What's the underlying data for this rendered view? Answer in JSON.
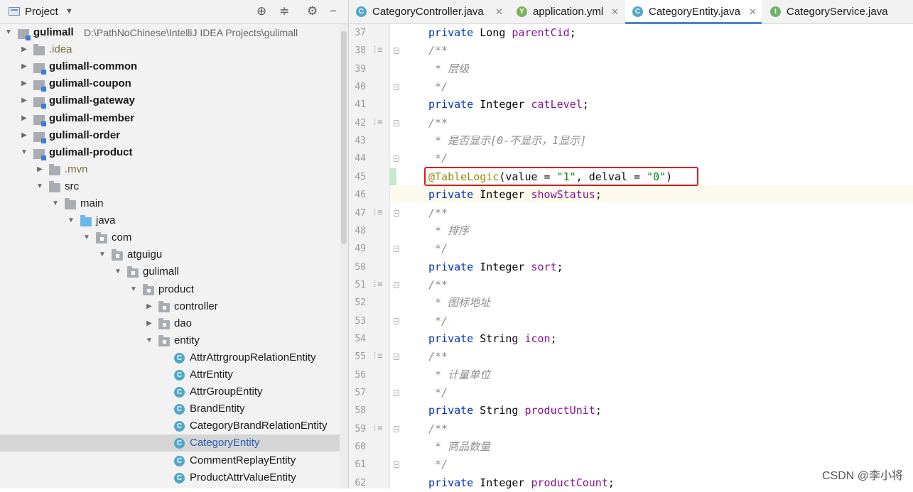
{
  "project": {
    "title": "Project",
    "tree": [
      {
        "label": "gulimall",
        "path": "D:\\PathNoChinese\\IntelliJ IDEA Projects\\gulimall",
        "icon": "module",
        "depth": 0,
        "expanded": true,
        "bold": true
      },
      {
        "label": ".idea",
        "icon": "folder",
        "depth": 1,
        "expanded": false,
        "hint": true
      },
      {
        "label": "gulimall-common",
        "icon": "module",
        "depth": 1,
        "expanded": false,
        "bold": true
      },
      {
        "label": "gulimall-coupon",
        "icon": "module",
        "depth": 1,
        "expanded": false,
        "bold": true
      },
      {
        "label": "gulimall-gateway",
        "icon": "module",
        "depth": 1,
        "expanded": false,
        "bold": true
      },
      {
        "label": "gulimall-member",
        "icon": "module",
        "depth": 1,
        "expanded": false,
        "bold": true
      },
      {
        "label": "gulimall-order",
        "icon": "module",
        "depth": 1,
        "expanded": false,
        "bold": true
      },
      {
        "label": "gulimall-product",
        "icon": "module",
        "depth": 1,
        "expanded": true,
        "bold": true
      },
      {
        "label": ".mvn",
        "icon": "folder",
        "depth": 2,
        "expanded": false,
        "hint": true
      },
      {
        "label": "src",
        "icon": "folder",
        "depth": 2,
        "expanded": true
      },
      {
        "label": "main",
        "icon": "folder",
        "depth": 3,
        "expanded": true
      },
      {
        "label": "java",
        "icon": "folder-blue",
        "depth": 4,
        "expanded": true
      },
      {
        "label": "com",
        "icon": "package",
        "depth": 5,
        "expanded": true
      },
      {
        "label": "atguigu",
        "icon": "package",
        "depth": 6,
        "expanded": true
      },
      {
        "label": "gulimall",
        "icon": "package",
        "depth": 7,
        "expanded": true
      },
      {
        "label": "product",
        "icon": "package",
        "depth": 8,
        "expanded": true
      },
      {
        "label": "controller",
        "icon": "package",
        "depth": 9,
        "expanded": false
      },
      {
        "label": "dao",
        "icon": "package",
        "depth": 9,
        "expanded": false
      },
      {
        "label": "entity",
        "icon": "package",
        "depth": 9,
        "expanded": true
      },
      {
        "label": "AttrAttrgroupRelationEntity",
        "icon": "class",
        "depth": 10
      },
      {
        "label": "AttrEntity",
        "icon": "class",
        "depth": 10
      },
      {
        "label": "AttrGroupEntity",
        "icon": "class",
        "depth": 10
      },
      {
        "label": "BrandEntity",
        "icon": "class",
        "depth": 10
      },
      {
        "label": "CategoryBrandRelationEntity",
        "icon": "class",
        "depth": 10
      },
      {
        "label": "CategoryEntity",
        "icon": "class",
        "depth": 10,
        "selected": true
      },
      {
        "label": "CommentReplayEntity",
        "icon": "class",
        "depth": 10
      },
      {
        "label": "ProductAttrValueEntity",
        "icon": "class",
        "depth": 10
      }
    ]
  },
  "tabs": [
    {
      "label": "CategoryController.java",
      "icon": "C",
      "color": "#4fa7c9",
      "closable": true,
      "active": false
    },
    {
      "label": "application.yml",
      "icon": "Y",
      "color": "#7bb35a",
      "closable": true,
      "active": false
    },
    {
      "label": "CategoryEntity.java",
      "icon": "C",
      "color": "#4fa7c9",
      "closable": true,
      "active": true
    },
    {
      "label": "CategoryService.java",
      "icon": "I",
      "color": "#6cb36a",
      "closable": false,
      "active": false
    }
  ],
  "code": [
    {
      "n": "37",
      "tokens": [
        [
          "kw",
          "private "
        ],
        [
          "",
          "Long "
        ],
        [
          "fld",
          "parentCid"
        ],
        [
          "",
          ";"
        ]
      ]
    },
    {
      "n": "38",
      "comment": true,
      "fold": true,
      "text": "/**"
    },
    {
      "n": "39",
      "comment": true,
      "text": " * 层级"
    },
    {
      "n": "40",
      "comment": true,
      "foldEnd": true,
      "text": " */"
    },
    {
      "n": "41",
      "tokens": [
        [
          "kw",
          "private "
        ],
        [
          "",
          "Integer "
        ],
        [
          "fld",
          "catLevel"
        ],
        [
          "",
          ";"
        ]
      ]
    },
    {
      "n": "42",
      "comment": true,
      "fold": true,
      "text": "/**"
    },
    {
      "n": "43",
      "comment": true,
      "text": " * 是否显示[0-不显示，1显示]"
    },
    {
      "n": "44",
      "comment": true,
      "foldEnd": true,
      "text": " */"
    },
    {
      "n": "45",
      "tokens": [
        [
          "ann",
          "@TableLogic"
        ],
        [
          "",
          "(value = "
        ],
        [
          "str",
          "\"1\""
        ],
        [
          "",
          ", delval = "
        ],
        [
          "str",
          "\"0\""
        ],
        [
          "",
          ")"
        ]
      ]
    },
    {
      "n": "46",
      "tokens": [
        [
          "kw",
          "private "
        ],
        [
          "",
          "Integer "
        ],
        [
          "fld",
          "showStatus"
        ],
        [
          "",
          ";"
        ]
      ]
    },
    {
      "n": "47",
      "comment": true,
      "fold": true,
      "text": "/**"
    },
    {
      "n": "48",
      "comment": true,
      "text": " * 排序"
    },
    {
      "n": "49",
      "comment": true,
      "foldEnd": true,
      "text": " */"
    },
    {
      "n": "50",
      "tokens": [
        [
          "kw",
          "private "
        ],
        [
          "",
          "Integer "
        ],
        [
          "fld",
          "sort"
        ],
        [
          "",
          ";"
        ]
      ]
    },
    {
      "n": "51",
      "comment": true,
      "fold": true,
      "text": "/**"
    },
    {
      "n": "52",
      "comment": true,
      "text": " * 图标地址"
    },
    {
      "n": "53",
      "comment": true,
      "foldEnd": true,
      "text": " */"
    },
    {
      "n": "54",
      "tokens": [
        [
          "kw",
          "private "
        ],
        [
          "",
          "String "
        ],
        [
          "fld",
          "icon"
        ],
        [
          "",
          ";"
        ]
      ]
    },
    {
      "n": "55",
      "comment": true,
      "fold": true,
      "text": "/**"
    },
    {
      "n": "56",
      "comment": true,
      "text": " * 计量单位"
    },
    {
      "n": "57",
      "comment": true,
      "foldEnd": true,
      "text": " */"
    },
    {
      "n": "58",
      "tokens": [
        [
          "kw",
          "private "
        ],
        [
          "",
          "String "
        ],
        [
          "fld",
          "productUnit"
        ],
        [
          "",
          ";"
        ]
      ]
    },
    {
      "n": "59",
      "comment": true,
      "fold": true,
      "text": "/**"
    },
    {
      "n": "60",
      "comment": true,
      "text": " * 商品数量"
    },
    {
      "n": "61",
      "comment": true,
      "foldEnd": true,
      "text": " */"
    },
    {
      "n": "62",
      "tokens": [
        [
          "kw",
          "private "
        ],
        [
          "",
          "Integer "
        ],
        [
          "fld",
          "productCount"
        ],
        [
          "",
          ";"
        ]
      ]
    }
  ],
  "watermark": "CSDN @李小将"
}
